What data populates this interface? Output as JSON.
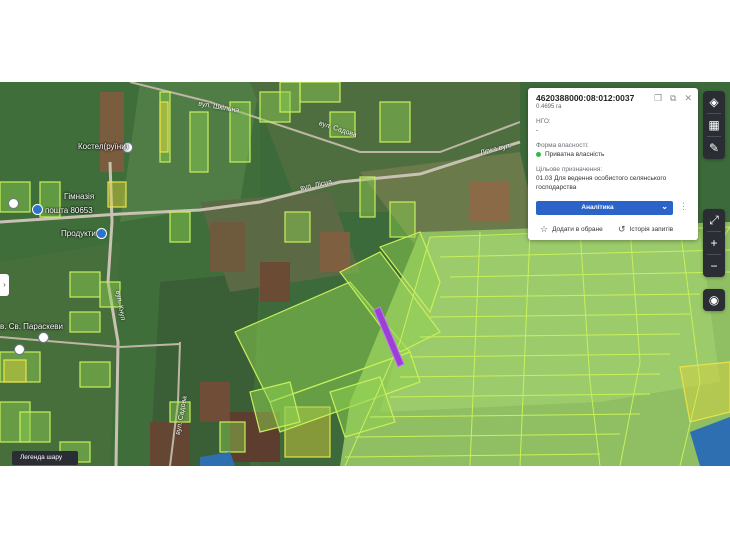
{
  "map": {
    "place_labels": [
      {
        "name": "settlement-label",
        "text": "Костел(руїни)"
      },
      {
        "name": "school-label",
        "text": "Гімназія"
      },
      {
        "name": "post-label",
        "text": "пошта 80653"
      },
      {
        "name": "shop-label",
        "text": "Продукти"
      },
      {
        "name": "church-label",
        "text": "в. Св. Параскеви"
      }
    ],
    "road_labels": [
      {
        "name": "road-label-1",
        "text": "вул. Шкільна"
      },
      {
        "name": "road-label-2",
        "text": "вул. Садова"
      },
      {
        "name": "road-label-3",
        "text": "вул. Лісна"
      },
      {
        "name": "road-label-4",
        "text": "Лiпка вул."
      },
      {
        "name": "road-label-5",
        "text": "вул. Кнуп"
      },
      {
        "name": "road-label-6",
        "text": "вул. Садова"
      }
    ]
  },
  "parcel_card": {
    "cadastral_number": "4620388000:08:012:0037",
    "area": "0.4695 га",
    "ngo_label": "НГО:",
    "ngo_value": "-",
    "ownership_label": "Форма власності:",
    "ownership_value": "Приватна власність",
    "ownership_color": "#35b84a",
    "purpose_label": "Цільове призначення:",
    "purpose_value_line1": "01.03 Для ведення особистого селянського",
    "purpose_value_line2": "господарства",
    "analytics_label": "Аналітика",
    "favorite_label": "Додати в обране",
    "history_label": "Історія запитів",
    "icons": [
      "copy-icon",
      "open-external-icon",
      "close-icon"
    ]
  },
  "toolbar": {
    "top_icons": [
      "layers-icon",
      "cadastre-layer-icon",
      "ruler-icon"
    ],
    "bottom_icons": [
      "fullscreen-icon",
      "zoom-in-icon",
      "zoom-out-icon",
      "locate-icon"
    ]
  },
  "legend_label": "Легенда шару",
  "colors": {
    "parcel_fill": "#8fd14f",
    "parcel_stroke": "#c8f05a",
    "selected_parcel": "#9b3fd6",
    "brand_blue": "#2b63c9"
  }
}
